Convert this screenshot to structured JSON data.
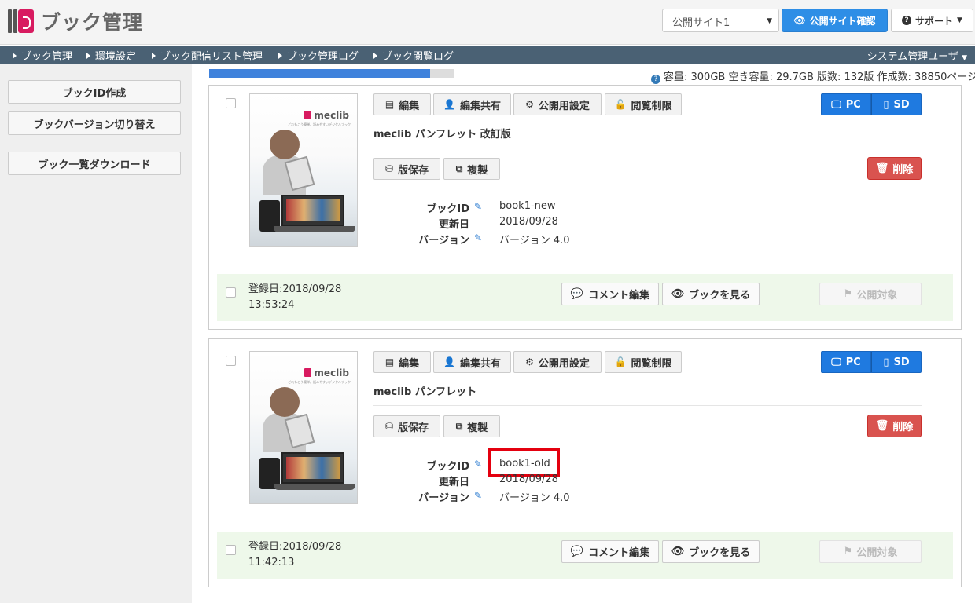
{
  "header": {
    "app_title": "ブック管理",
    "site_select": {
      "value": "公開サイト1"
    },
    "confirm_button": "公開サイト確認",
    "support_button": "サポート"
  },
  "nav": {
    "items": [
      "ブック管理",
      "環境設定",
      "ブック配信リスト管理",
      "ブック管理ログ",
      "ブック閲覧ログ"
    ],
    "user_menu": "システム管理ユーザ"
  },
  "sidebar": {
    "buttons": [
      "ブックID作成",
      "ブックバージョン切り替え",
      "ブック一覧ダウンロード"
    ]
  },
  "status": {
    "usage_fraction": 0.9,
    "capacity_text": "容量: 300GB 空き容量: 29.7GB 版数: 132版 作成数: 38850ページ"
  },
  "toolbar_labels": {
    "edit": "編集",
    "share": "編集共有",
    "publish_settings": "公開用設定",
    "access_limit": "閲覧制限",
    "pc": "PC",
    "sd": "SD",
    "save_version": "版保存",
    "duplicate": "複製",
    "delete": "削除",
    "comment_edit": "コメント編集",
    "view_book": "ブックを見る",
    "publish_target": "公開対象"
  },
  "meta_labels": {
    "book_id": "ブックID",
    "updated": "更新日",
    "version": "バージョン"
  },
  "books": [
    {
      "thumb_logo": "meclib",
      "thumb_tagline": "どれもこう簡単。読みやすいデジタルブック",
      "title": "meclib パンフレット 改訂版",
      "book_id": "book1-new",
      "updated": "2018/09/28",
      "version": "バージョン 4.0",
      "reg_date": "登録日:2018/09/28",
      "reg_time": "13:53:24"
    },
    {
      "thumb_logo": "meclib",
      "thumb_tagline": "どれもこう簡単。読みやすいデジタルブック",
      "title": "meclib パンフレット",
      "book_id": "book1-old",
      "updated": "2018/09/28",
      "version": "バージョン 4.0",
      "reg_date": "登録日:2018/09/28",
      "reg_time": "11:42:13"
    }
  ],
  "colors": {
    "nav_bg": "#4a6174",
    "primary": "#1f7ae0",
    "danger": "#d9534f",
    "footer_bg": "#eef8ea",
    "highlight": "#e4000f",
    "brand": "#d81b60"
  }
}
